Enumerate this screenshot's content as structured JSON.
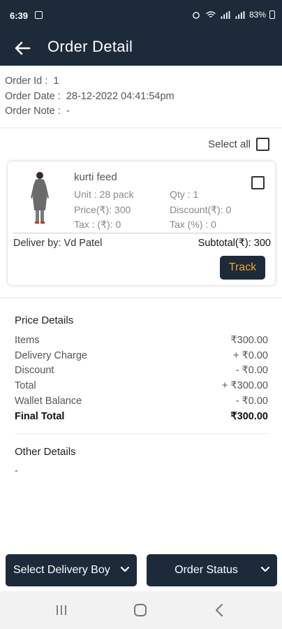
{
  "status_bar": {
    "time": "6:39",
    "battery": "83%"
  },
  "header": {
    "title": "Order Detail"
  },
  "order": {
    "id_label": "Order Id :",
    "id": "1",
    "date_label": "Order Date :",
    "date": "28-12-2022 04:41:54pm",
    "note_label": "Order Note :",
    "note": "-"
  },
  "select_all_label": "Select all",
  "item": {
    "name": "kurti feed",
    "unit": "Unit : 28 pack",
    "qty": "Qty : 1",
    "price": "Price(₹): 300",
    "discount": "Discount(₹): 0",
    "tax_amount": "Tax : (₹): 0",
    "tax_percent": "Tax (%) : 0",
    "deliver_by": "Deliver by: Vd Patel",
    "subtotal": "Subtotal(₹): 300",
    "track_label": "Track"
  },
  "price_details": {
    "title": "Price Details",
    "rows": [
      {
        "label": "Items",
        "value": "₹300.00"
      },
      {
        "label": "Delivery Charge",
        "value": "+ ₹0.00"
      },
      {
        "label": "Discount",
        "value": "- ₹0.00"
      },
      {
        "label": "Total",
        "value": "+ ₹300.00"
      },
      {
        "label": "Wallet Balance",
        "value": "- ₹0.00"
      },
      {
        "label": "Final Total",
        "value": "₹300.00"
      }
    ]
  },
  "other_details": {
    "title": "Other Details",
    "value": "-"
  },
  "buttons": {
    "delivery_boy": "Select Delivery Boy",
    "order_status": "Order Status"
  },
  "colors": {
    "primary": "#1c2a3a",
    "accent": "#f5a623"
  }
}
